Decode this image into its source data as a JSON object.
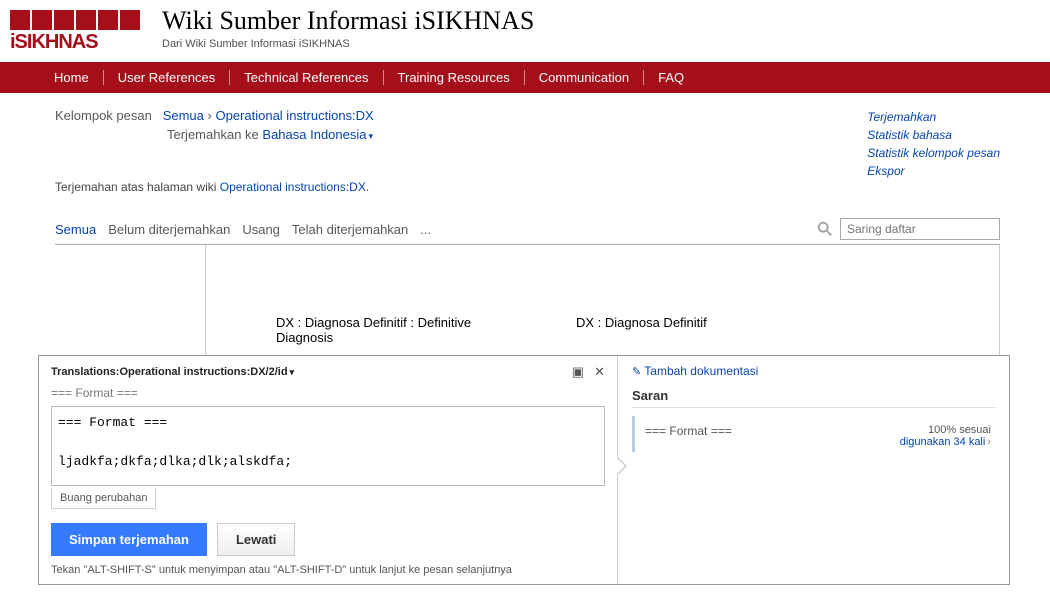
{
  "header": {
    "title": "Wiki Sumber Informasi iSIKHNAS",
    "subtitle": "Dari Wiki Sumber Informasi iSIKHNAS",
    "logo_text": "iSIKHNAS"
  },
  "nav": {
    "items": [
      "Home",
      "User References",
      "Technical References",
      "Training Resources",
      "Communication",
      "FAQ"
    ]
  },
  "breadcrumb": {
    "label": "Kelompok pesan",
    "all": "Semua",
    "sep": "›",
    "page": "Operational instructions:DX",
    "translate_to": "Terjemahkan ke",
    "lang": "Bahasa Indonesia"
  },
  "side": {
    "items": [
      "Terjemahkan",
      "Statistik bahasa",
      "Statistik kelompok pesan",
      "Ekspor"
    ]
  },
  "note": {
    "prefix": "Terjemahan atas halaman wiki ",
    "link": "Operational instructions:DX",
    "suffix": "."
  },
  "filters": {
    "items": [
      "Semua",
      "Belum diterjemahkan",
      "Usang",
      "Telah diterjemahkan",
      "..."
    ],
    "active": 0
  },
  "search": {
    "placeholder": "Saring daftar"
  },
  "main": {
    "left": "DX : Diagnosa Definitif : Definitive Diagnosis",
    "right": "DX : Diagnosa Definitif"
  },
  "editor": {
    "title": "Translations:Operational instructions:DX/2/id",
    "header2": "=== Format ===",
    "textarea": "=== Format ===\n\nljadkfa;dkfa;dlka;dlk;alskdfa;",
    "discard": "Buang perubahan",
    "save": "Simpan terjemahan",
    "skip": "Lewati",
    "hint": "Tekan \"ALT-SHIFT-S\" untuk menyimpan atau \"ALT-SHIFT-D\" untuk lanjut ke pesan selanjutnya",
    "add_doc": "Tambah dokumentasi",
    "saran_title": "Saran",
    "saran_text": "=== Format ===",
    "saran_pct": "100% sesuai",
    "saran_used": "digunakan 34 kali"
  }
}
